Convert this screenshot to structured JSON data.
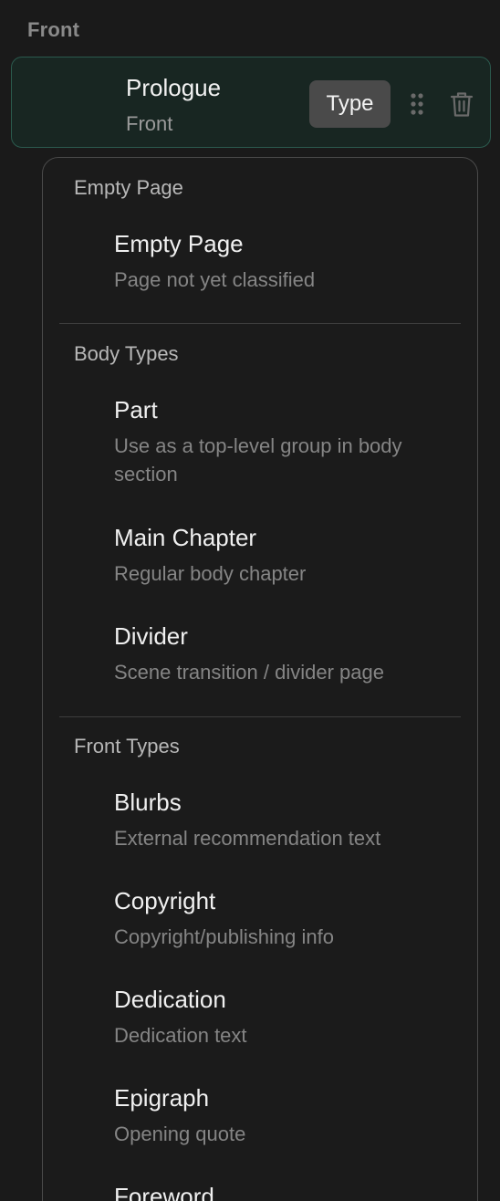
{
  "section": {
    "header": "Front"
  },
  "selected": {
    "title": "Prologue",
    "subtitle": "Front",
    "type_button": "Type"
  },
  "icons": {
    "drag": "drag-handle-icon",
    "trash": "trash-icon"
  },
  "menu": {
    "groups": [
      {
        "label": "Empty Page",
        "options": [
          {
            "title": "Empty Page",
            "desc": "Page not yet classified"
          }
        ]
      },
      {
        "label": "Body Types",
        "options": [
          {
            "title": "Part",
            "desc": "Use as a top-level group in body section"
          },
          {
            "title": "Main Chapter",
            "desc": "Regular body chapter"
          },
          {
            "title": "Divider",
            "desc": "Scene transition / divider page"
          }
        ]
      },
      {
        "label": "Front Types",
        "options": [
          {
            "title": "Blurbs",
            "desc": "External recommendation text"
          },
          {
            "title": "Copyright",
            "desc": "Copyright/publishing info"
          },
          {
            "title": "Dedication",
            "desc": "Dedication text"
          },
          {
            "title": "Epigraph",
            "desc": "Opening quote"
          },
          {
            "title": "Foreword",
            "desc": ""
          }
        ]
      }
    ]
  }
}
